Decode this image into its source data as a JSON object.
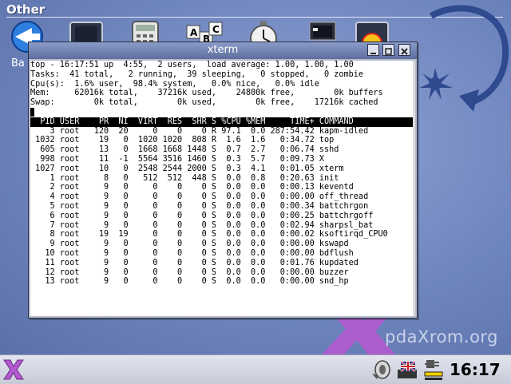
{
  "desktop": {
    "category_title": "Other",
    "launchers": [
      {
        "icon": "mail-arrow-icon",
        "label": "Ba"
      },
      {
        "icon": "monitor-icon"
      },
      {
        "icon": "calculator-icon"
      },
      {
        "icon": "abc-blocks-icon"
      },
      {
        "icon": "stopwatch-icon"
      },
      {
        "icon": "laptop-icon"
      },
      {
        "icon": "shell-icon"
      }
    ],
    "watermark": "pdaXrom.org"
  },
  "xterm": {
    "title": "xterm",
    "summary": [
      "top - 16:17:51 up  4:55,  2 users,  load average: 1.00, 1.00, 1.00",
      "Tasks:  41 total,   2 running,  39 sleeping,   0 stopped,   0 zombie",
      "Cpu(s):  1.6% user,  98.4% system,   0.0% nice,   0.0% idle",
      "Mem:     62016k total,    37216k used,    24800k free,        0k buffers",
      "Swap:        0k total,        0k used,        0k free,    17216k cached"
    ],
    "header": {
      "pid": "PID",
      "user": "USER",
      "pr": "PR",
      "ni": "NI",
      "virt": "VIRT",
      "res": "RES",
      "shr": "SHR",
      "s": "S",
      "cpu": "%CPU",
      "mem": "%MEM",
      "time": "TIME+",
      "command": "COMMAND"
    },
    "processes": [
      {
        "pid": "3",
        "user": "root",
        "pr": "120",
        "ni": "20",
        "virt": "0",
        "res": "0",
        "shr": "0",
        "s": "R",
        "cpu": "97.1",
        "mem": "0.0",
        "time": "287:54.42",
        "command": "kapm-idled"
      },
      {
        "pid": "1032",
        "user": "root",
        "pr": "19",
        "ni": "0",
        "virt": "1020",
        "res": "1020",
        "shr": "808",
        "s": "R",
        "cpu": "1.6",
        "mem": "1.6",
        "time": "0:34.72",
        "command": "top"
      },
      {
        "pid": "605",
        "user": "root",
        "pr": "13",
        "ni": "0",
        "virt": "1668",
        "res": "1668",
        "shr": "1448",
        "s": "S",
        "cpu": "0.7",
        "mem": "2.7",
        "time": "0:06.74",
        "command": "sshd"
      },
      {
        "pid": "998",
        "user": "root",
        "pr": "11",
        "ni": "-1",
        "virt": "5564",
        "res": "3516",
        "shr": "1460",
        "s": "S",
        "cpu": "0.3",
        "mem": "5.7",
        "time": "0:09.73",
        "command": "X"
      },
      {
        "pid": "1027",
        "user": "root",
        "pr": "10",
        "ni": "0",
        "virt": "2548",
        "res": "2544",
        "shr": "2000",
        "s": "S",
        "cpu": "0.3",
        "mem": "4.1",
        "time": "0:01.05",
        "command": "xterm"
      },
      {
        "pid": "1",
        "user": "root",
        "pr": "8",
        "ni": "0",
        "virt": "512",
        "res": "512",
        "shr": "448",
        "s": "S",
        "cpu": "0.0",
        "mem": "0.8",
        "time": "0:20.63",
        "command": "init"
      },
      {
        "pid": "2",
        "user": "root",
        "pr": "9",
        "ni": "0",
        "virt": "0",
        "res": "0",
        "shr": "0",
        "s": "S",
        "cpu": "0.0",
        "mem": "0.0",
        "time": "0:00.13",
        "command": "keventd"
      },
      {
        "pid": "4",
        "user": "root",
        "pr": "9",
        "ni": "0",
        "virt": "0",
        "res": "0",
        "shr": "0",
        "s": "S",
        "cpu": "0.0",
        "mem": "0.0",
        "time": "0:00.00",
        "command": "off_thread"
      },
      {
        "pid": "5",
        "user": "root",
        "pr": "9",
        "ni": "0",
        "virt": "0",
        "res": "0",
        "shr": "0",
        "s": "S",
        "cpu": "0.0",
        "mem": "0.0",
        "time": "0:00.34",
        "command": "battchrgon"
      },
      {
        "pid": "6",
        "user": "root",
        "pr": "9",
        "ni": "0",
        "virt": "0",
        "res": "0",
        "shr": "0",
        "s": "S",
        "cpu": "0.0",
        "mem": "0.0",
        "time": "0:00.25",
        "command": "battchrgoff"
      },
      {
        "pid": "7",
        "user": "root",
        "pr": "9",
        "ni": "0",
        "virt": "0",
        "res": "0",
        "shr": "0",
        "s": "S",
        "cpu": "0.0",
        "mem": "0.0",
        "time": "0:02.94",
        "command": "sharpsl_bat"
      },
      {
        "pid": "8",
        "user": "root",
        "pr": "19",
        "ni": "19",
        "virt": "0",
        "res": "0",
        "shr": "0",
        "s": "S",
        "cpu": "0.0",
        "mem": "0.0",
        "time": "0:00.02",
        "command": "ksoftirqd_CPU0"
      },
      {
        "pid": "9",
        "user": "root",
        "pr": "9",
        "ni": "0",
        "virt": "0",
        "res": "0",
        "shr": "0",
        "s": "S",
        "cpu": "0.0",
        "mem": "0.0",
        "time": "0:00.00",
        "command": "kswapd"
      },
      {
        "pid": "10",
        "user": "root",
        "pr": "9",
        "ni": "0",
        "virt": "0",
        "res": "0",
        "shr": "0",
        "s": "S",
        "cpu": "0.0",
        "mem": "0.0",
        "time": "0:00.00",
        "command": "bdflush"
      },
      {
        "pid": "11",
        "user": "root",
        "pr": "9",
        "ni": "0",
        "virt": "0",
        "res": "0",
        "shr": "0",
        "s": "S",
        "cpu": "0.0",
        "mem": "0.0",
        "time": "0:01.76",
        "command": "kupdated"
      },
      {
        "pid": "12",
        "user": "root",
        "pr": "9",
        "ni": "0",
        "virt": "0",
        "res": "0",
        "shr": "0",
        "s": "S",
        "cpu": "0.0",
        "mem": "0.0",
        "time": "0:00.00",
        "command": "buzzer"
      },
      {
        "pid": "13",
        "user": "root",
        "pr": "9",
        "ni": "0",
        "virt": "0",
        "res": "0",
        "shr": "0",
        "s": "S",
        "cpu": "0.0",
        "mem": "0.0",
        "time": "0:00.00",
        "command": "snd_hp"
      }
    ]
  },
  "taskbar": {
    "clock": "16:17",
    "tray": [
      "speaker-icon",
      "keyboard-flag-icon",
      "power-plug-icon"
    ]
  },
  "colors": {
    "desktop": "#6f85bd",
    "titlebar": "#5e6f9e",
    "header_row": "#000000",
    "accent_x": "#b45ad0"
  }
}
